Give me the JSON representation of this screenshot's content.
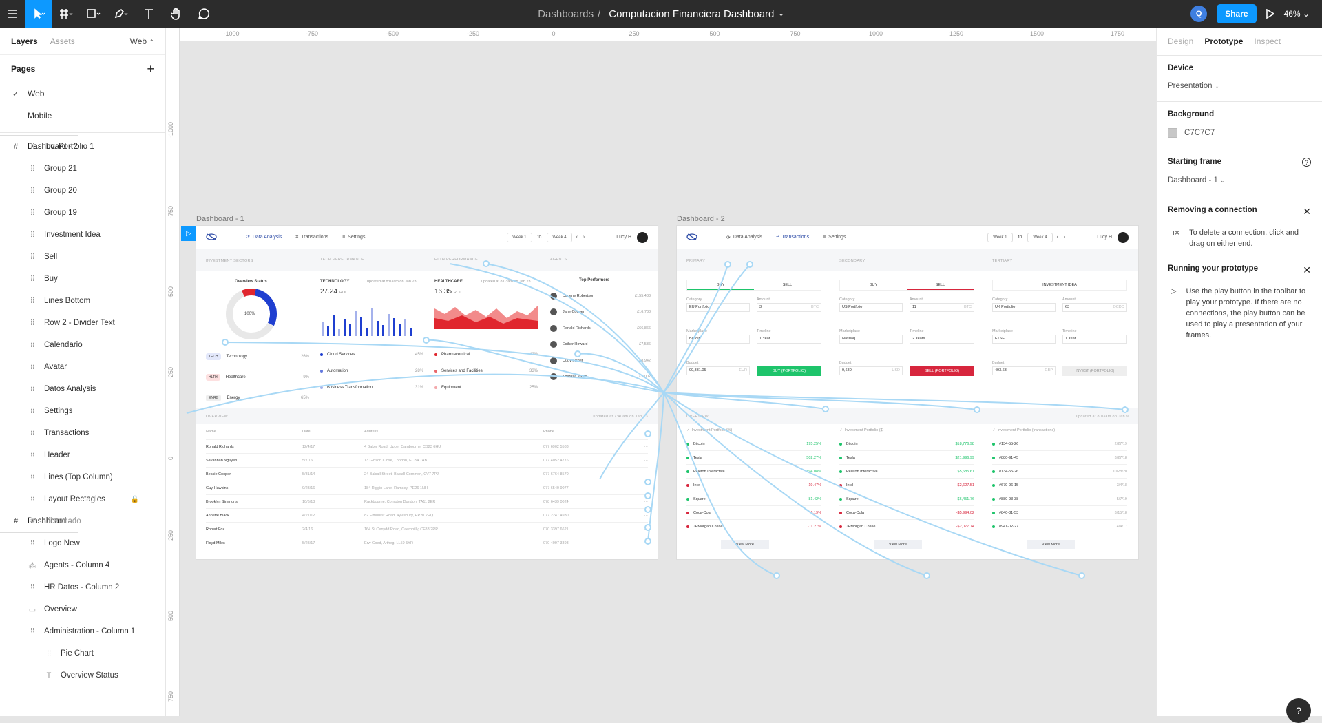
{
  "topbar": {
    "breadcrumb_project": "Dashboards",
    "breadcrumb_sep": "/",
    "breadcrumb_file": "Computacion Financiera Dashboard",
    "avatar_initial": "Q",
    "share_label": "Share",
    "zoom": "46%"
  },
  "left_panel": {
    "tab_layers": "Layers",
    "tab_assets": "Assets",
    "page_selector": "Web",
    "pages_title": "Pages",
    "pages": [
      "Web",
      "Mobile"
    ],
    "layers": [
      {
        "name": "Dashboard - 2",
        "type": "frame"
      },
      {
        "name": "Inv. Portfolio 1",
        "type": "group"
      },
      {
        "name": "Group 21",
        "type": "group"
      },
      {
        "name": "Group 20",
        "type": "group"
      },
      {
        "name": "Group 19",
        "type": "group"
      },
      {
        "name": "Investment Idea",
        "type": "group"
      },
      {
        "name": "Sell",
        "type": "group"
      },
      {
        "name": "Buy",
        "type": "group"
      },
      {
        "name": "Lines Bottom",
        "type": "group"
      },
      {
        "name": "Row 2 - Divider Text",
        "type": "group"
      },
      {
        "name": "Calendario",
        "type": "group"
      },
      {
        "name": "Avatar",
        "type": "group"
      },
      {
        "name": "Datos Analysis",
        "type": "group"
      },
      {
        "name": "Settings",
        "type": "group"
      },
      {
        "name": "Transactions",
        "type": "group"
      },
      {
        "name": "Header",
        "type": "group"
      },
      {
        "name": "Lines (Top Column)",
        "type": "group"
      },
      {
        "name": "Layout Rectagles",
        "type": "group",
        "locked": true
      },
      {
        "name": "Dashboard - 1",
        "type": "frame"
      },
      {
        "name": "uil:tornado",
        "type": "icon"
      },
      {
        "name": "Logo New",
        "type": "group"
      },
      {
        "name": "Agents - Column 4",
        "type": "component"
      },
      {
        "name": "HR Datos - Column 2",
        "type": "group"
      },
      {
        "name": "Overview",
        "type": "rect"
      },
      {
        "name": "Administration - Column 1",
        "type": "group"
      },
      {
        "name": "Pie Chart",
        "type": "group"
      },
      {
        "name": "Overview Status",
        "type": "text"
      }
    ]
  },
  "right_panel": {
    "tab_design": "Design",
    "tab_prototype": "Prototype",
    "tab_inspect": "Inspect",
    "device_title": "Device",
    "device_value": "Presentation",
    "background_title": "Background",
    "background_hex": "C7C7C7",
    "starting_frame_title": "Starting frame",
    "starting_frame_value": "Dashboard - 1",
    "removing_title": "Removing a connection",
    "removing_text": "To delete a connection, click and drag on either end.",
    "running_title": "Running your prototype",
    "running_text": "Use the play button in the toolbar to play your prototype. If there are no connections, the play button can be used to play a presentation of your frames.",
    "help": "?"
  },
  "rulers": {
    "top": [
      "-1000",
      "-750",
      "-500",
      "-250",
      "0",
      "250",
      "500",
      "750",
      "1000",
      "1250",
      "1500",
      "1750"
    ],
    "left": [
      "-1000",
      "-750",
      "-500",
      "-250",
      "0",
      "250",
      "500",
      "750"
    ]
  },
  "frame1": {
    "label": "Dashboard - 1",
    "nav": [
      "Data Analysis",
      "Transactions",
      "Settings"
    ],
    "week_from": "Week 1",
    "to": "to",
    "week_to": "Week 4",
    "user": "Lucy H.",
    "sections": [
      "INVESTMENT SECTORS",
      "TECH PERFORMANCE",
      "HLTH PERFORMANCE",
      "AGENTS"
    ],
    "overview_status": "Overview Status",
    "donut_label": "100%",
    "sectors": [
      {
        "tag": "TECH",
        "name": "Technology",
        "pct": "26%"
      },
      {
        "tag": "HLTH",
        "name": "Healthcare",
        "pct": "9%"
      },
      {
        "tag": "ENRG",
        "name": "Energy",
        "pct": "65%"
      }
    ],
    "tech": {
      "title": "TECHNOLOGY",
      "roi": "27.24",
      "roi_unit": "ROI",
      "updated": "updated at 8:03am on Jan 23",
      "items": [
        {
          "name": "Cloud Services",
          "pct": "45%"
        },
        {
          "name": "Automation",
          "pct": "28%"
        },
        {
          "name": "Business Transformation",
          "pct": "31%"
        }
      ]
    },
    "health": {
      "title": "HEALTHCARE",
      "roi": "16.35",
      "roi_unit": "ROI",
      "updated": "updated at 8:03am on Jan 23",
      "items": [
        {
          "name": "Pharmaceutical",
          "pct": "42%"
        },
        {
          "name": "Services and Facilities",
          "pct": "33%"
        },
        {
          "name": "Equipment",
          "pct": "25%"
        }
      ]
    },
    "agents": {
      "title": "Top Performers",
      "list": [
        {
          "name": "Darlene Robertson",
          "value": "£155,483"
        },
        {
          "name": "Jane Cooper",
          "value": "£16,788"
        },
        {
          "name": "Ronald Richards",
          "value": "£66,866"
        },
        {
          "name": "Esther Howard",
          "value": "£7,536"
        },
        {
          "name": "Cody Fisher",
          "value": "£8,942"
        },
        {
          "name": "Theresa Webb",
          "value": "£9,002"
        }
      ]
    },
    "overview_title": "OVERVIEW",
    "overview_updated": "updated at 7:40am on Jan 23",
    "table_headers": [
      "Name",
      "Date",
      "Address",
      "Phone"
    ],
    "rows": [
      [
        "Ronald Richards",
        "12/4/17",
        "4 Baker Road, Upper Cambourne, CB23 6HU",
        "077 6902 5583"
      ],
      [
        "Savannah Nguyen",
        "5/7/16",
        "13 Gibson Close, London, EC3A 7AB",
        "077 4052 4776"
      ],
      [
        "Bessie Cooper",
        "5/31/14",
        "24 Balsall Street, Balsall Common, CV7 7PJ",
        "077 6764 8570"
      ],
      [
        "Guy Hawkins",
        "9/23/16",
        "184 Riggin Lane, Ramsey, PE26 1NH",
        "077 6540 9077"
      ],
      [
        "Brooklyn Simmons",
        "10/6/13",
        "Rackbourne, Compton Dundon, TA11 2ER",
        "078 6439 0024"
      ],
      [
        "Annette Black",
        "4/21/12",
        "82 Elmhurst Road, Aylesbury, HP20 2HQ",
        "077 2247 4930"
      ],
      [
        "Robert Fox",
        "2/4/16",
        "164 St Cenydd Road, Caerphilly, CF83 2RP",
        "070 3397 6621"
      ],
      [
        "Floyd Miles",
        "5/28/17",
        "Erw Goed, Artheg, LL59 5YR",
        "070 4097 3393"
      ]
    ]
  },
  "frame2": {
    "label": "Dashboard - 2",
    "nav": [
      "Data Analysis",
      "Transactions",
      "Settings"
    ],
    "week_from": "Week 1",
    "to": "to",
    "week_to": "Week 4",
    "user": "Lucy H.",
    "columns": [
      {
        "section": "PRIMARY",
        "tab_a": "BUY",
        "tab_b": "SELL",
        "category": "EU Portfolio",
        "amount": "3",
        "amount_unit": "BTC",
        "marketplace": "Bitcoin",
        "timeline": "1 Year",
        "budget": "99,331.05",
        "budget_unit": "EUR",
        "action": "BUY (PORTFOLIO)",
        "action_color": "#1ec46b"
      },
      {
        "section": "SECONDARY",
        "tab_a": "BUY",
        "tab_b": "SELL",
        "category": "US Portfolio",
        "amount": "11",
        "amount_unit": "BTC",
        "marketplace": "Nasdaq",
        "timeline": "2 Years",
        "budget": "9,680",
        "budget_unit": "USD",
        "action": "SELL (PORTFOLIO)",
        "action_color": "#d7263d"
      },
      {
        "section": "TERTIARY",
        "tab_a": "INVESTMENT IDEA",
        "tab_b": "",
        "category": "UK Portfolio",
        "amount": "63",
        "amount_unit": "OCDO",
        "marketplace": "FTSE",
        "timeline": "1 Year",
        "budget": "493.63",
        "budget_unit": "GBP",
        "action": "INVEST (PORTFOLIO)",
        "action_color": "#eeeeee"
      }
    ],
    "field_labels": {
      "category": "Category",
      "amount": "Amount",
      "marketplace": "Marketplace",
      "timeline": "Timeline",
      "budget": "Budget"
    },
    "overview_title": "OVERVIEW",
    "overview_updated": "updated at 8:03am on Jan 9",
    "panels": [
      {
        "title": "Investment Portfolio (%)",
        "rows": [
          [
            "Bitcoin",
            "195.25%"
          ],
          [
            "Tesla",
            "502.27%"
          ],
          [
            "Peleton Interactive",
            "194.08%"
          ],
          [
            "Intel",
            "-19.47%"
          ],
          [
            "Square",
            "81.42%"
          ],
          [
            "Coca-Cola",
            "-6.19%"
          ],
          [
            "JPMorgan Chase",
            "-11.27%"
          ]
        ]
      },
      {
        "title": "Investment Portfolio ($)",
        "rows": [
          [
            "Bitcoin",
            "$18,776.98"
          ],
          [
            "Tesla",
            "$21,996.99"
          ],
          [
            "Peleton Interactive",
            "$5,685.61"
          ],
          [
            "Intel",
            "-$2,627.51"
          ],
          [
            "Square",
            "$6,451.76"
          ],
          [
            "Coca-Cola",
            "-$5,994.02"
          ],
          [
            "JPMorgan Chase",
            "-$2,077.74"
          ]
        ]
      },
      {
        "title": "Investment Portfolio (transactions)",
        "rows": [
          [
            "#134-55-26",
            "2/27/19"
          ],
          [
            "#880-91-45",
            "3/27/18"
          ],
          [
            "#134-55-26",
            "10/28/20"
          ],
          [
            "#679-96-15",
            "3/4/18"
          ],
          [
            "#880-93-38",
            "5/7/19"
          ],
          [
            "#840-31-53",
            "3/15/18"
          ],
          [
            "#941-02-27",
            "4/4/17"
          ]
        ]
      }
    ],
    "view_more": "View More"
  },
  "colors": {
    "accent": "#0d99ff",
    "topbar": "#2c2c2c",
    "canvas": "#e5e5e5",
    "connection": "#a8d8f5"
  }
}
